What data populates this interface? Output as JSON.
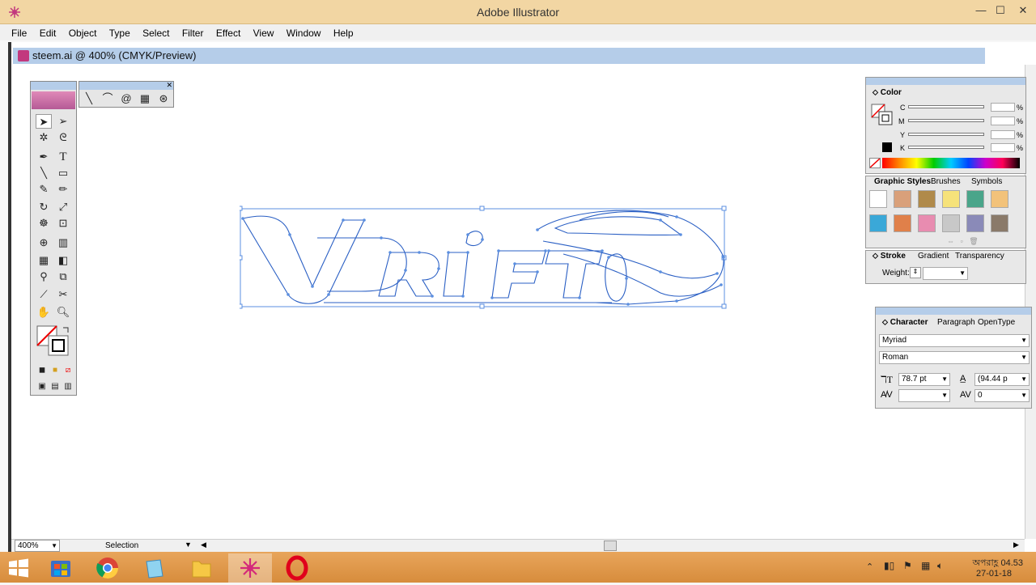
{
  "app": {
    "title": "Adobe Illustrator"
  },
  "window_controls": {
    "minimize": "—",
    "maximize": "☐",
    "close": "✕"
  },
  "menu": [
    "File",
    "Edit",
    "Object",
    "Type",
    "Select",
    "Filter",
    "Effect",
    "View",
    "Window",
    "Help"
  ],
  "document": {
    "title": "steem.ai @ 400% (CMYK/Preview)"
  },
  "artwork": {
    "letters": "VDRIFT"
  },
  "color_panel": {
    "tab": "Color",
    "channels": [
      "C",
      "M",
      "Y",
      "K"
    ],
    "unit": "%"
  },
  "graphic_styles_panel": {
    "tabs": [
      "Graphic Styles",
      "Brushes",
      "Symbols"
    ],
    "swatch_colors": [
      "#ffffff",
      "#d9a07a",
      "#b08a4a",
      "#f6e27a",
      "#4aa58a",
      "#f2c27a",
      "#3aa8d8",
      "#e0804a",
      "#e88cb0",
      "#c8c8c8",
      "#8a8ab8",
      "#8a7a6a"
    ]
  },
  "stroke_panel": {
    "tabs": [
      "Stroke",
      "Gradient",
      "Transparency"
    ],
    "weight_label": "Weight:"
  },
  "character_panel": {
    "tabs": [
      "Character",
      "Paragraph",
      "OpenType"
    ],
    "font": "Myriad",
    "style": "Roman",
    "size": "78.7 pt",
    "leading": "(94.44 p",
    "tracking": "0"
  },
  "statusbar": {
    "zoom": "400%",
    "status": "Selection"
  },
  "taskbar": {
    "clock_time": "অপরাহ্ণ 04.53",
    "clock_date": "27-01-18"
  },
  "colors": {
    "accent": "#5b8fe0",
    "titlebar": "#f2d6a3",
    "taskbar": "#dc9446"
  }
}
